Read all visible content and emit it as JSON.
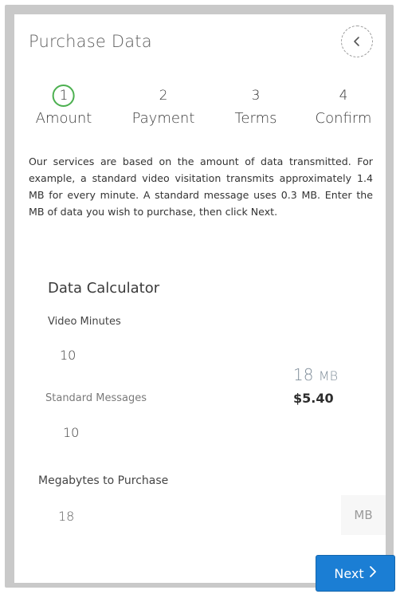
{
  "header": {
    "title": "Purchase Data"
  },
  "steps": [
    {
      "number": "1",
      "label": "Amount",
      "active": true
    },
    {
      "number": "2",
      "label": "Payment",
      "active": false
    },
    {
      "number": "3",
      "label": "Terms",
      "active": false
    },
    {
      "number": "4",
      "label": "Confirm",
      "active": false
    }
  ],
  "description": "Our services are based on the amount of data transmitted. For example, a standard video visitation transmits approximately 1.4 MB for every minute. A standard message uses 0.3 MB. Enter the MB of data you wish to purchase, then click Next.",
  "calculator": {
    "title": "Data Calculator",
    "video_label": "Video Minutes",
    "video_value": "10",
    "messages_label": "Standard Messages",
    "messages_value": "10",
    "result_mb": "18",
    "result_unit": "MB",
    "result_price": "$5.40"
  },
  "purchase": {
    "label": "Megabytes to Purchase",
    "value": "18",
    "unit": "MB"
  },
  "actions": {
    "next_label": "Next"
  },
  "colors": {
    "accent": "#1b7ed4",
    "active_step": "#4cb050"
  },
  "icons": {
    "back": "chevron-left-icon",
    "next": "chevron-right-icon"
  }
}
